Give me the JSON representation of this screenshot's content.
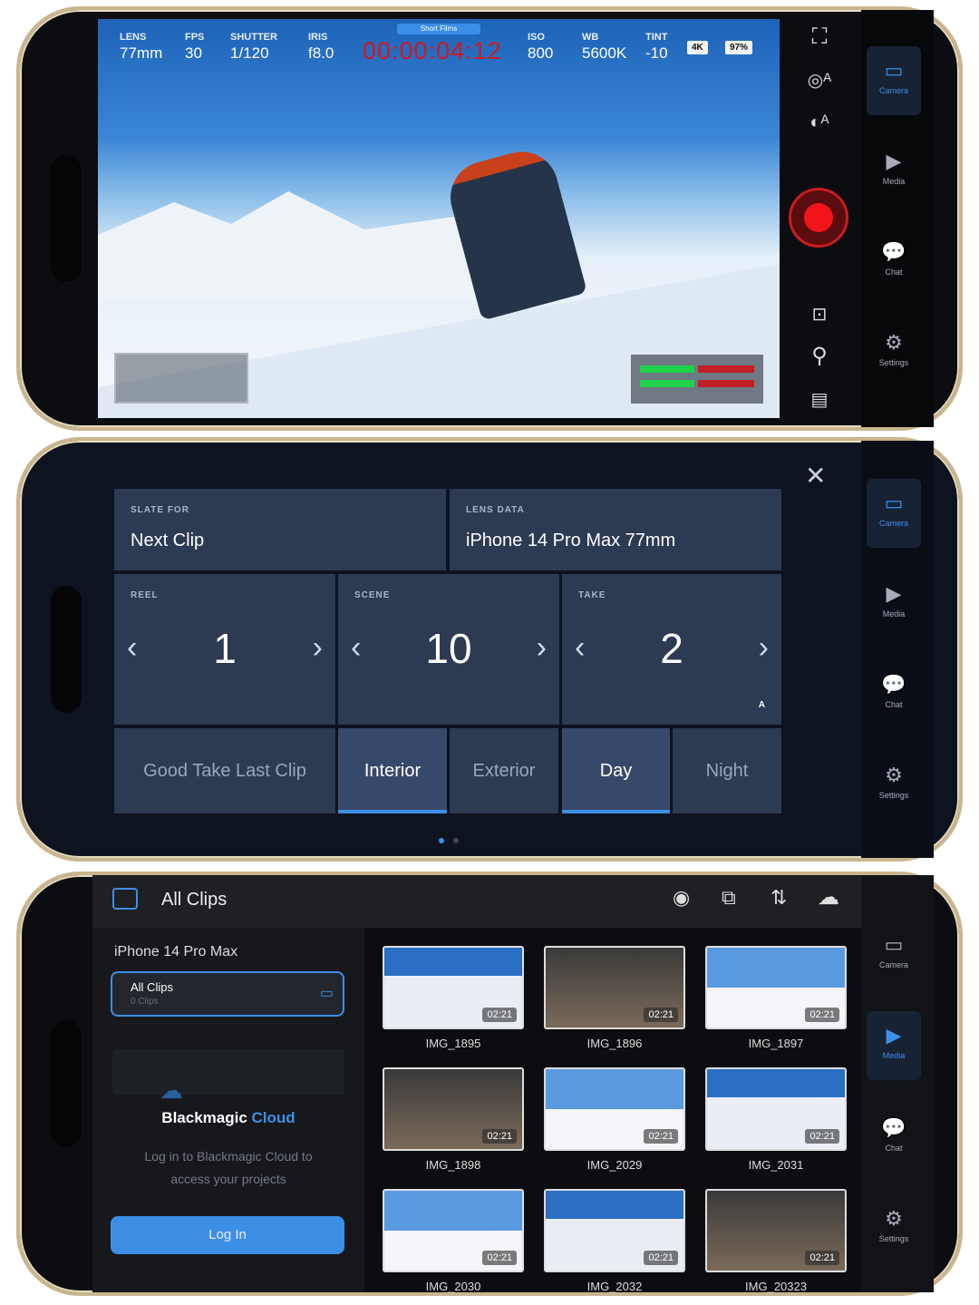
{
  "camera": {
    "project": "Short Films",
    "readouts": [
      {
        "label": "LENS",
        "value": "77mm"
      },
      {
        "label": "FPS",
        "value": "30"
      },
      {
        "label": "SHUTTER",
        "value": "1/120"
      },
      {
        "label": "IRIS",
        "value": "f8.0"
      }
    ],
    "readouts_right": [
      {
        "label": "ISO",
        "value": "800"
      },
      {
        "label": "WB",
        "value": "5600K"
      },
      {
        "label": "TINT",
        "value": "-10"
      }
    ],
    "timecode": "00:00:04:12",
    "resolution": "4K",
    "battery": "97%",
    "recording": true,
    "record_color": "#f1141b"
  },
  "nav": [
    {
      "label": "Camera",
      "icon": "camera-icon"
    },
    {
      "label": "Media",
      "icon": "media-icon"
    },
    {
      "label": "Chat",
      "icon": "chat-icon"
    },
    {
      "label": "Settings",
      "icon": "gear-icon"
    }
  ],
  "slate": {
    "slate_for_label": "SLATE FOR",
    "slate_for": "Next Clip",
    "lens_label": "LENS DATA",
    "lens": "iPhone 14 Pro Max 77mm",
    "reel_label": "REEL",
    "reel": "1",
    "scene_label": "SCENE",
    "scene": "10",
    "take_label": "TAKE",
    "take": "2",
    "take_mode": "A",
    "options": [
      {
        "label": "Good Take Last Clip",
        "active": false
      },
      {
        "label": "Interior",
        "active": true
      },
      {
        "label": "Exterior",
        "active": false
      },
      {
        "label": "Day",
        "active": true
      },
      {
        "label": "Night",
        "active": false
      }
    ],
    "page": 1,
    "pages": 2
  },
  "media": {
    "title": "All Clips",
    "device": "iPhone 14 Pro Max",
    "album": {
      "name": "All Clips",
      "count": "0 Clips"
    },
    "cloud": {
      "brand1": "Blackmagic",
      "brand2": "Cloud",
      "text1": "Log in to Blackmagic Cloud to",
      "text2": "access your projects",
      "button": "Log In"
    },
    "accent": "#3d8fe6",
    "clips": [
      {
        "name": "IMG_1895",
        "duration": "02:21"
      },
      {
        "name": "IMG_1896",
        "duration": "02:21"
      },
      {
        "name": "IMG_1897",
        "duration": "02:21"
      },
      {
        "name": "IMG_1898",
        "duration": "02:21"
      },
      {
        "name": "IMG_2029",
        "duration": "02:21"
      },
      {
        "name": "IMG_2031",
        "duration": "02:21"
      },
      {
        "name": "IMG_2030",
        "duration": "02:21"
      },
      {
        "name": "IMG_2032",
        "duration": "02:21"
      },
      {
        "name": "IMG_20323",
        "duration": "02:21"
      }
    ]
  }
}
